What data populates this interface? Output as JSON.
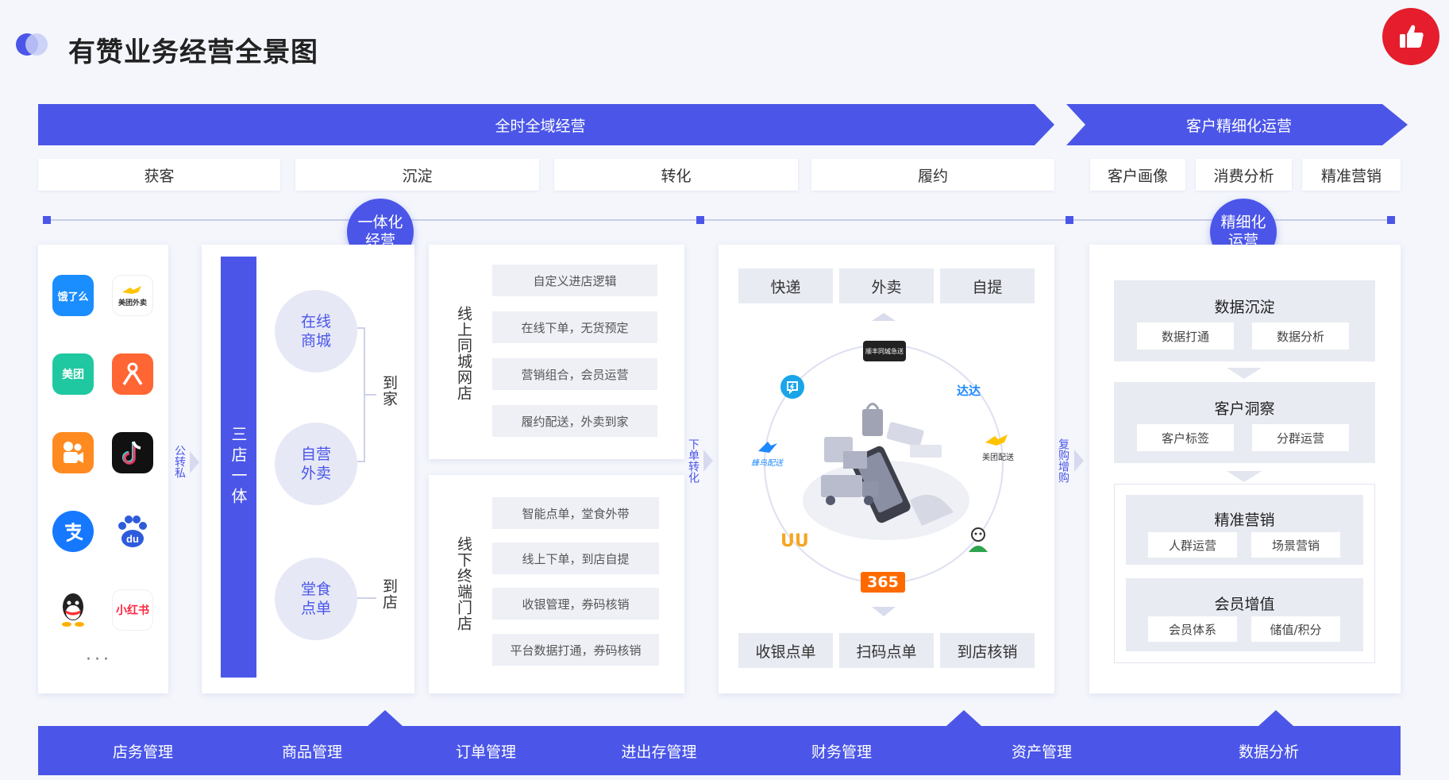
{
  "title": "有赞业务经营全景图",
  "colors": {
    "primary": "#4b56e8",
    "background": "#f4f6fc",
    "panel": "#ffffff",
    "chip": "#eef0f6"
  },
  "banners": {
    "left": "全时全域经营",
    "right": "客户精细化运营"
  },
  "stages": [
    "获客",
    "沉淀",
    "转化",
    "履约"
  ],
  "stages_right": [
    "客户画像",
    "消费分析",
    "精准营销"
  ],
  "bubbles": {
    "left": "一体化\n经营",
    "right": "精细化\n运营"
  },
  "apps": [
    {
      "name": "饿了么",
      "icon": "eleme-icon",
      "color": "#1a8dff"
    },
    {
      "name": "美团外卖",
      "icon": "meituan-waimai-icon",
      "color": "#ffd100"
    },
    {
      "name": "美团",
      "icon": "meituan-icon",
      "color": "#1fc8a0"
    },
    {
      "name": "",
      "icon": "dianping-icon",
      "color": "#ff6633"
    },
    {
      "name": "",
      "icon": "kuaishou-icon",
      "color": "#ff8a1f"
    },
    {
      "name": "",
      "icon": "douyin-icon",
      "color": "#111111"
    },
    {
      "name": "",
      "icon": "alipay-icon",
      "color": "#1678ff"
    },
    {
      "name": "du",
      "icon": "baidu-icon",
      "color": "#2d5bdc"
    },
    {
      "name": "",
      "icon": "qq-icon",
      "color": "#222222"
    },
    {
      "name": "小红书",
      "icon": "xiaohongshu-icon",
      "color": "#ff2442"
    }
  ],
  "apps_more": "···",
  "flow_label_1": "公转私",
  "three_store": "三店一体",
  "circles": [
    "在线\n商城",
    "自营\n外卖",
    "堂食\n点单"
  ],
  "to_home": "到家",
  "to_store": "到店",
  "online_store": {
    "label": "线上同城网店",
    "items": [
      "自定义进店逻辑",
      "在线下单，无货预定",
      "营销组合，会员运营",
      "履约配送，外卖到家"
    ]
  },
  "offline_store": {
    "label": "线下终端门店",
    "items": [
      "智能点单，堂食外带",
      "线上下单，到店自提",
      "收银管理，券码核销",
      "平台数据打通，券码核销"
    ]
  },
  "flow_label_2": "下单转化",
  "fulfill_top": [
    "快递",
    "外卖",
    "自提"
  ],
  "fulfill_bottom": [
    "收银点单",
    "扫码点单",
    "到店核销"
  ],
  "partners": {
    "sf": "顺丰同城急送",
    "dada": "达达",
    "meituan": "美团配送",
    "fengniao": "蜂鸟配送",
    "uu": "UU",
    "s365": "365"
  },
  "flow_label_3": "复购增购",
  "ops": {
    "data": {
      "title": "数据沉淀",
      "items": [
        "数据打通",
        "数据分析"
      ]
    },
    "insight": {
      "title": "客户洞察",
      "items": [
        "客户标签",
        "分群运营"
      ]
    },
    "marketing": {
      "title": "精准营销",
      "items": [
        "人群运营",
        "场景营销"
      ]
    },
    "member": {
      "title": "会员增值",
      "items": [
        "会员体系",
        "储值/积分"
      ]
    }
  },
  "bottom": [
    "店务管理",
    "商品管理",
    "订单管理",
    "进出存管理",
    "财务管理",
    "资产管理",
    "数据分析"
  ]
}
